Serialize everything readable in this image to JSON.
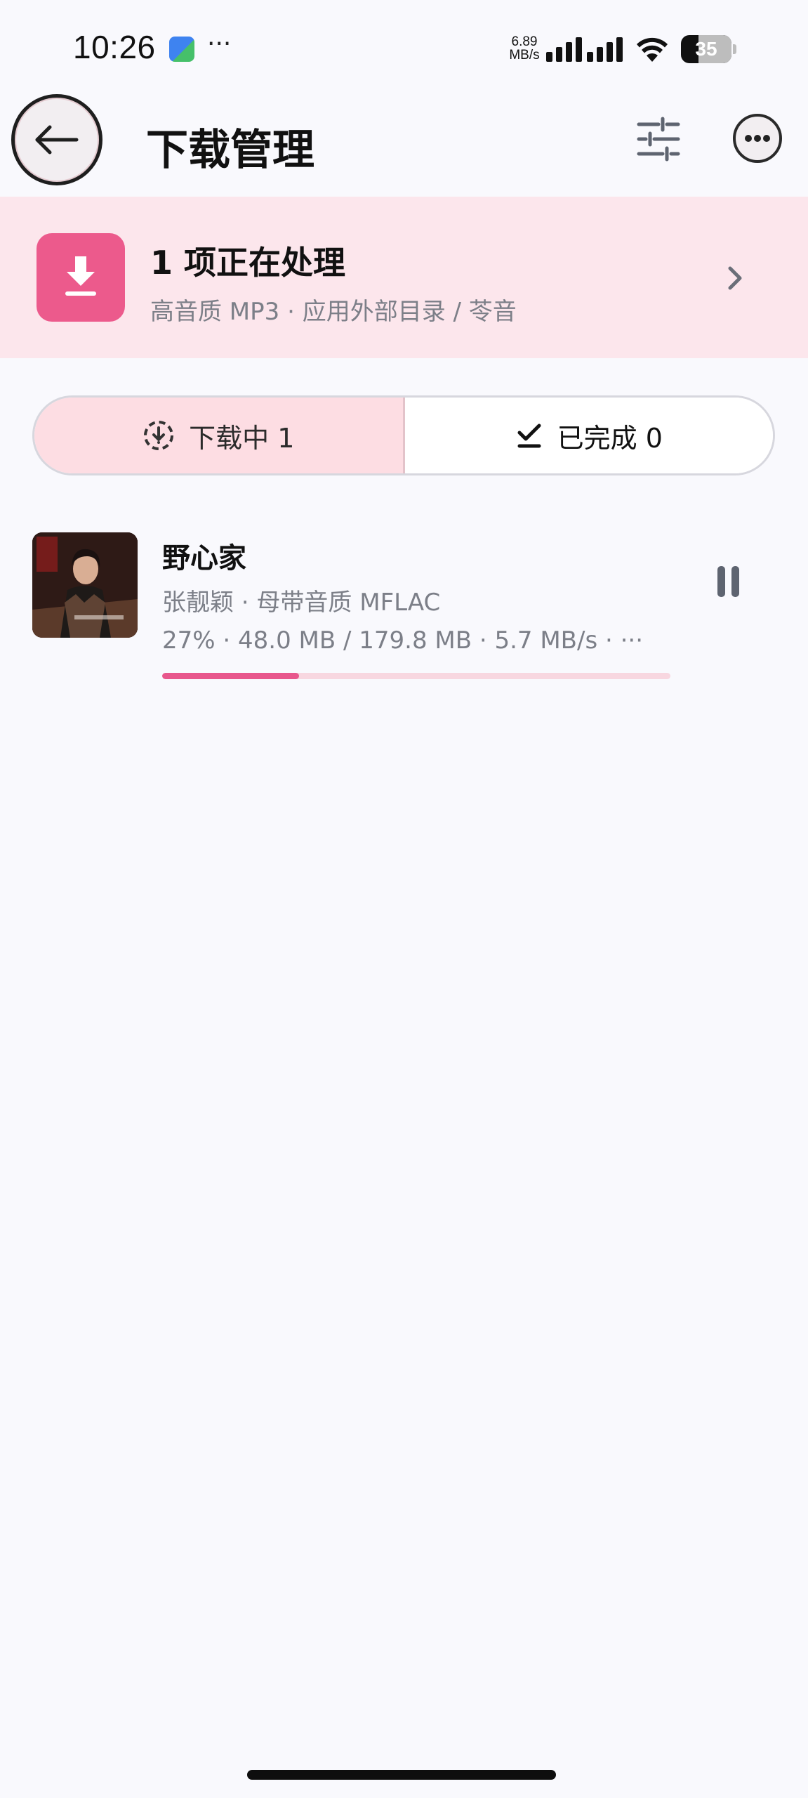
{
  "status_bar": {
    "time": "10:26",
    "overflow": "···",
    "net_speed_value": "6.89",
    "net_speed_unit": "MB/s",
    "battery": "35",
    "battery_level": 0.35
  },
  "header": {
    "title": "下载管理",
    "back_icon": "arrow-left-icon",
    "filter_icon": "sliders-icon",
    "more_icon": "more-horizontal-icon"
  },
  "banner": {
    "title": "1 项正在处理",
    "subtitle": "高音质 MP3 · 应用外部目录 / 苓音",
    "icon": "download-icon"
  },
  "tabs": [
    {
      "label": "下载中 1",
      "icon": "download-circle-icon",
      "selected": true
    },
    {
      "label": "已完成 0",
      "icon": "check-icon",
      "selected": false
    }
  ],
  "downloads": [
    {
      "title": "野心家",
      "meta": "张靓颖 · 母带音质 MFLAC",
      "progress_text": "27% · 48.0 MB / 179.8 MB · 5.7 MB/s · ···",
      "progress": 0.27
    }
  ],
  "colors": {
    "accent": "#E8578C",
    "banner_bg": "#FCE6EC",
    "tab_selected_bg": "#FDDDE3",
    "page_bg": "#F9F9FD"
  }
}
